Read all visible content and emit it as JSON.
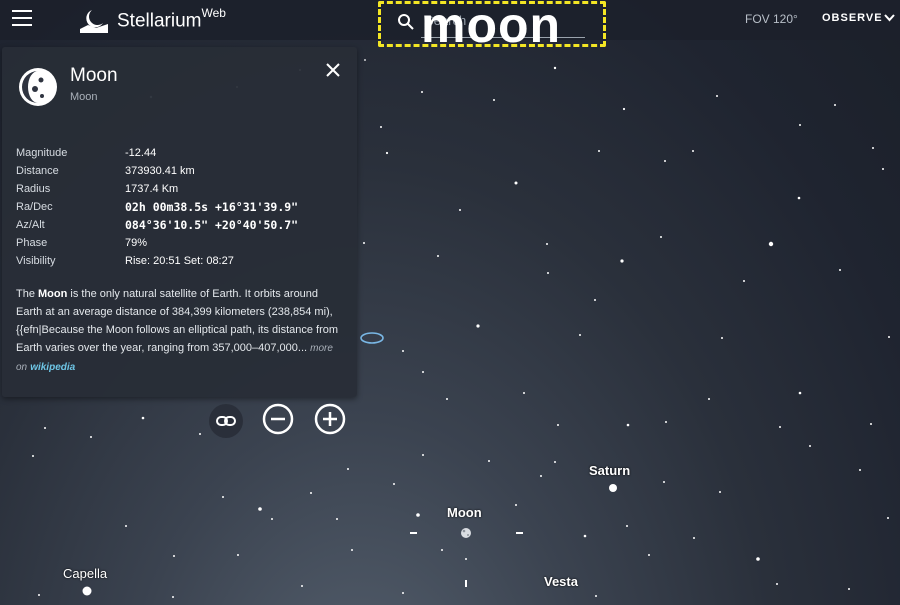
{
  "topbar": {
    "app_name": "Stellarium",
    "app_suffix": "Web",
    "search_value": "moon",
    "search_placeholder": "Search",
    "fov": "FOV 120°",
    "observe_label": "OBSERVE"
  },
  "info_panel": {
    "name": "Moon",
    "subtitle": "Moon",
    "properties": [
      {
        "label": "Magnitude",
        "value": "-12.44"
      },
      {
        "label": "Distance",
        "value": "373930.41 km"
      },
      {
        "label": "Radius",
        "value": "1737.4 Km"
      },
      {
        "label": "Ra/Dec",
        "value": "02h 00m38.5s  +16°31'39.9\""
      },
      {
        "label": "Az/Alt",
        "value": "084°36'10.5\"  +20°40'50.7\""
      },
      {
        "label": "Phase",
        "value": "79%"
      },
      {
        "label": "Visibility",
        "value": "Rise: 20:51   Set: 08:27"
      }
    ],
    "description_prefix": "The ",
    "description_bold": "Moon",
    "description_text": " is the only natural satellite of Earth. It orbits around Earth at an average distance of 384,399 kilometers (238,854 mi),{{efn|Because the Moon follows an elliptical path, its distance from Earth varies over the year, ranging from 357,000–407,000...",
    "more_on": "more on",
    "wiki_link": "wikipedia"
  },
  "sky_labels": {
    "saturn": "Saturn",
    "moon": "Moon",
    "capella": "Capella",
    "vesta": "Vesta"
  },
  "colors": {
    "accent_search_outline": "#f3e624",
    "wiki_link": "#6ec6e6",
    "panel_bg": "#282d37",
    "topbar_bg": "#1c212b"
  }
}
